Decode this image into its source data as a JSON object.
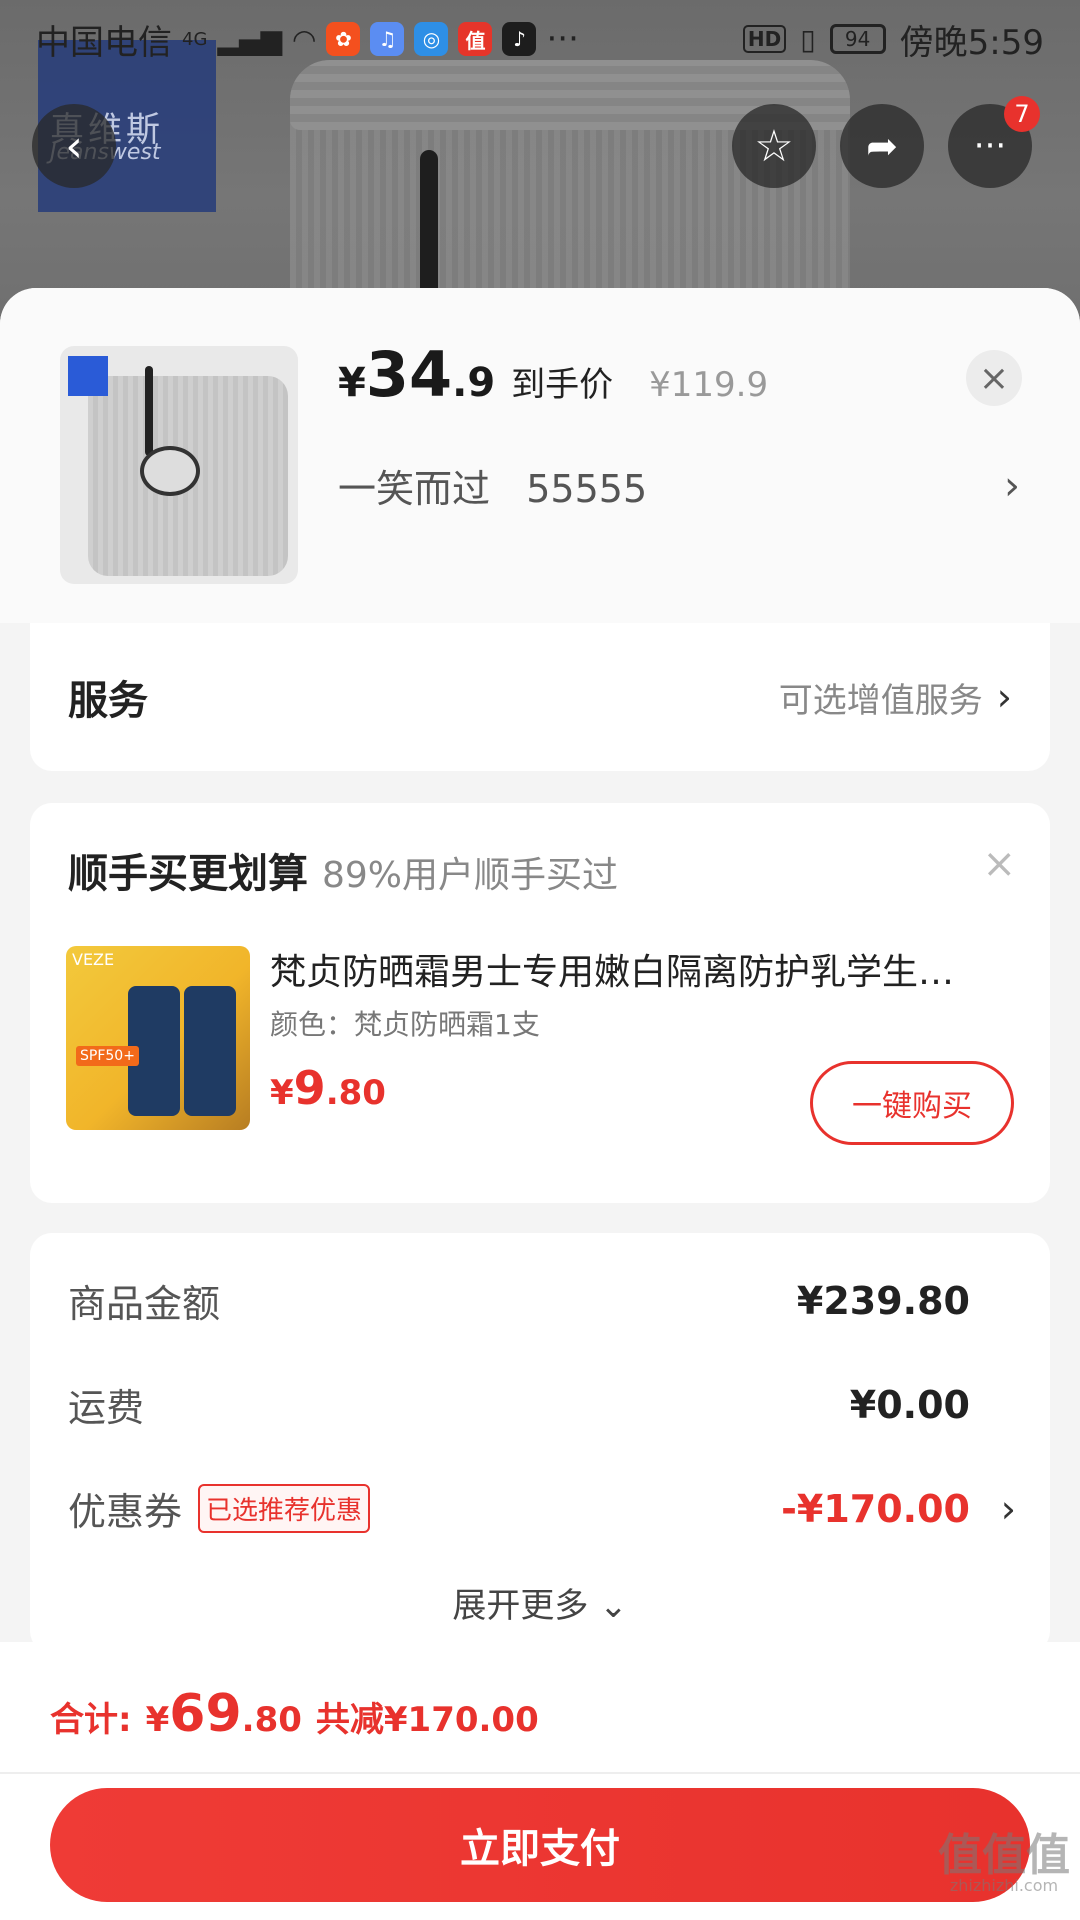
{
  "status_bar": {
    "carrier": "中国电信",
    "network": "4G",
    "more": "···",
    "hd": "HD",
    "battery": "94",
    "time": "傍晚5:59",
    "app_icons": [
      {
        "name": "kuaishou-icon",
        "glyph": "✿",
        "color": "#f4501e"
      },
      {
        "name": "music-icon",
        "glyph": "♫",
        "color": "#5b8df2"
      },
      {
        "name": "browser-icon",
        "glyph": "◎",
        "color": "#2e8fe6"
      },
      {
        "name": "zhide-icon",
        "glyph": "值",
        "color": "#e6352a"
      },
      {
        "name": "tiktok-icon",
        "glyph": "♪",
        "color": "#1d1d1d"
      }
    ]
  },
  "header_image": {
    "brand_cn": "真维斯",
    "brand_en": "Jeanswest"
  },
  "top_buttons": {
    "back_glyph": "‹",
    "favorite_glyph": "☆",
    "share_glyph": "➦",
    "more_glyph": "···",
    "more_badge": "7"
  },
  "product": {
    "price_yen": "¥",
    "price_int": "34",
    "price_dec": ".9",
    "price_tag": "到手价",
    "original_price": "¥119.9",
    "close_glyph": "×",
    "variant": "一笑而过   55555",
    "variant_chevron": "›"
  },
  "service": {
    "label": "服务",
    "hint": "可选增值服务",
    "chevron": "›"
  },
  "upsell": {
    "title": "顺手买更划算",
    "subtitle": "89%用户顺手买过",
    "close_glyph": "×",
    "image_brand": "VEZE",
    "image_spf": "SPF50+",
    "item_name": "梵贞防晒霜男士专用嫩白隔离防护乳学生…",
    "item_spec": "颜色：梵贞防晒霜1支",
    "price_yen": "¥",
    "price_int": "9",
    "price_dec": ".80",
    "buy_label": "一键购买"
  },
  "summary": {
    "rows": [
      {
        "label": "商品金额",
        "value": "¥239.80"
      },
      {
        "label": "运费",
        "value": "¥0.00"
      },
      {
        "label": "优惠券",
        "tag": "已选推荐优惠",
        "value": "-¥170.00",
        "chevron": "›"
      }
    ],
    "expand_label": "展开更多 ⌄"
  },
  "footer": {
    "total_label": "合计:",
    "total_yen": "¥",
    "total_int": "69",
    "total_dec": ".80",
    "saved": "共减¥170.00",
    "pay_label": "立即支付"
  },
  "watermark": {
    "text": "值值值",
    "url": "zhizhizhi.com"
  },
  "colors": {
    "accent": "#e8322d",
    "text_primary": "#222222",
    "text_secondary": "#888888"
  }
}
